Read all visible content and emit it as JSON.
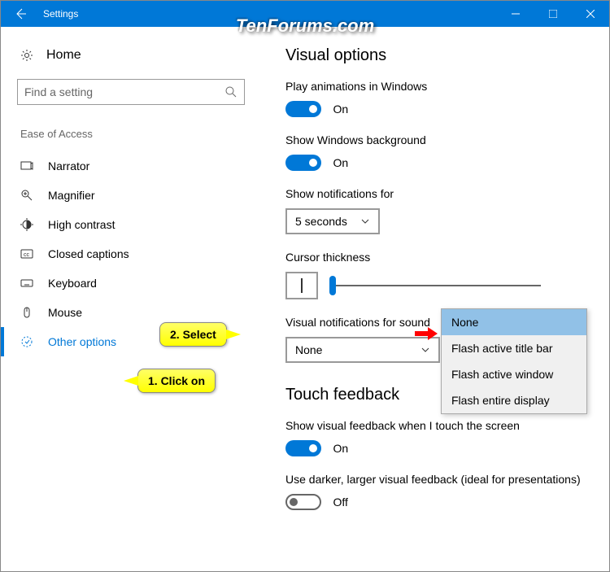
{
  "titlebar": {
    "title": "Settings"
  },
  "watermark": "TenForums.com",
  "sidebar": {
    "home": "Home",
    "searchPlaceholder": "Find a setting",
    "category": "Ease of Access",
    "items": [
      {
        "label": "Narrator"
      },
      {
        "label": "Magnifier"
      },
      {
        "label": "High contrast"
      },
      {
        "label": "Closed captions"
      },
      {
        "label": "Keyboard"
      },
      {
        "label": "Mouse"
      },
      {
        "label": "Other options"
      }
    ]
  },
  "main": {
    "heading1": "Visual options",
    "playAnimations": {
      "label": "Play animations in Windows",
      "state": "On"
    },
    "showBackground": {
      "label": "Show Windows background",
      "state": "On"
    },
    "showNotifications": {
      "label": "Show notifications for",
      "value": "5 seconds"
    },
    "cursorThickness": {
      "label": "Cursor thickness"
    },
    "visualNotifications": {
      "label": "Visual notifications for sound",
      "value": "None"
    },
    "heading2": "Touch feedback",
    "touchFeedback": {
      "label": "Show visual feedback when I touch the screen",
      "state": "On"
    },
    "darkerFeedback": {
      "label": "Use darker, larger visual feedback (ideal for presentations)",
      "state": "Off"
    }
  },
  "popup": {
    "options": [
      "None",
      "Flash active title bar",
      "Flash active window",
      "Flash entire display"
    ]
  },
  "callouts": {
    "c1": "1. Click on",
    "c2": "2. Select"
  }
}
